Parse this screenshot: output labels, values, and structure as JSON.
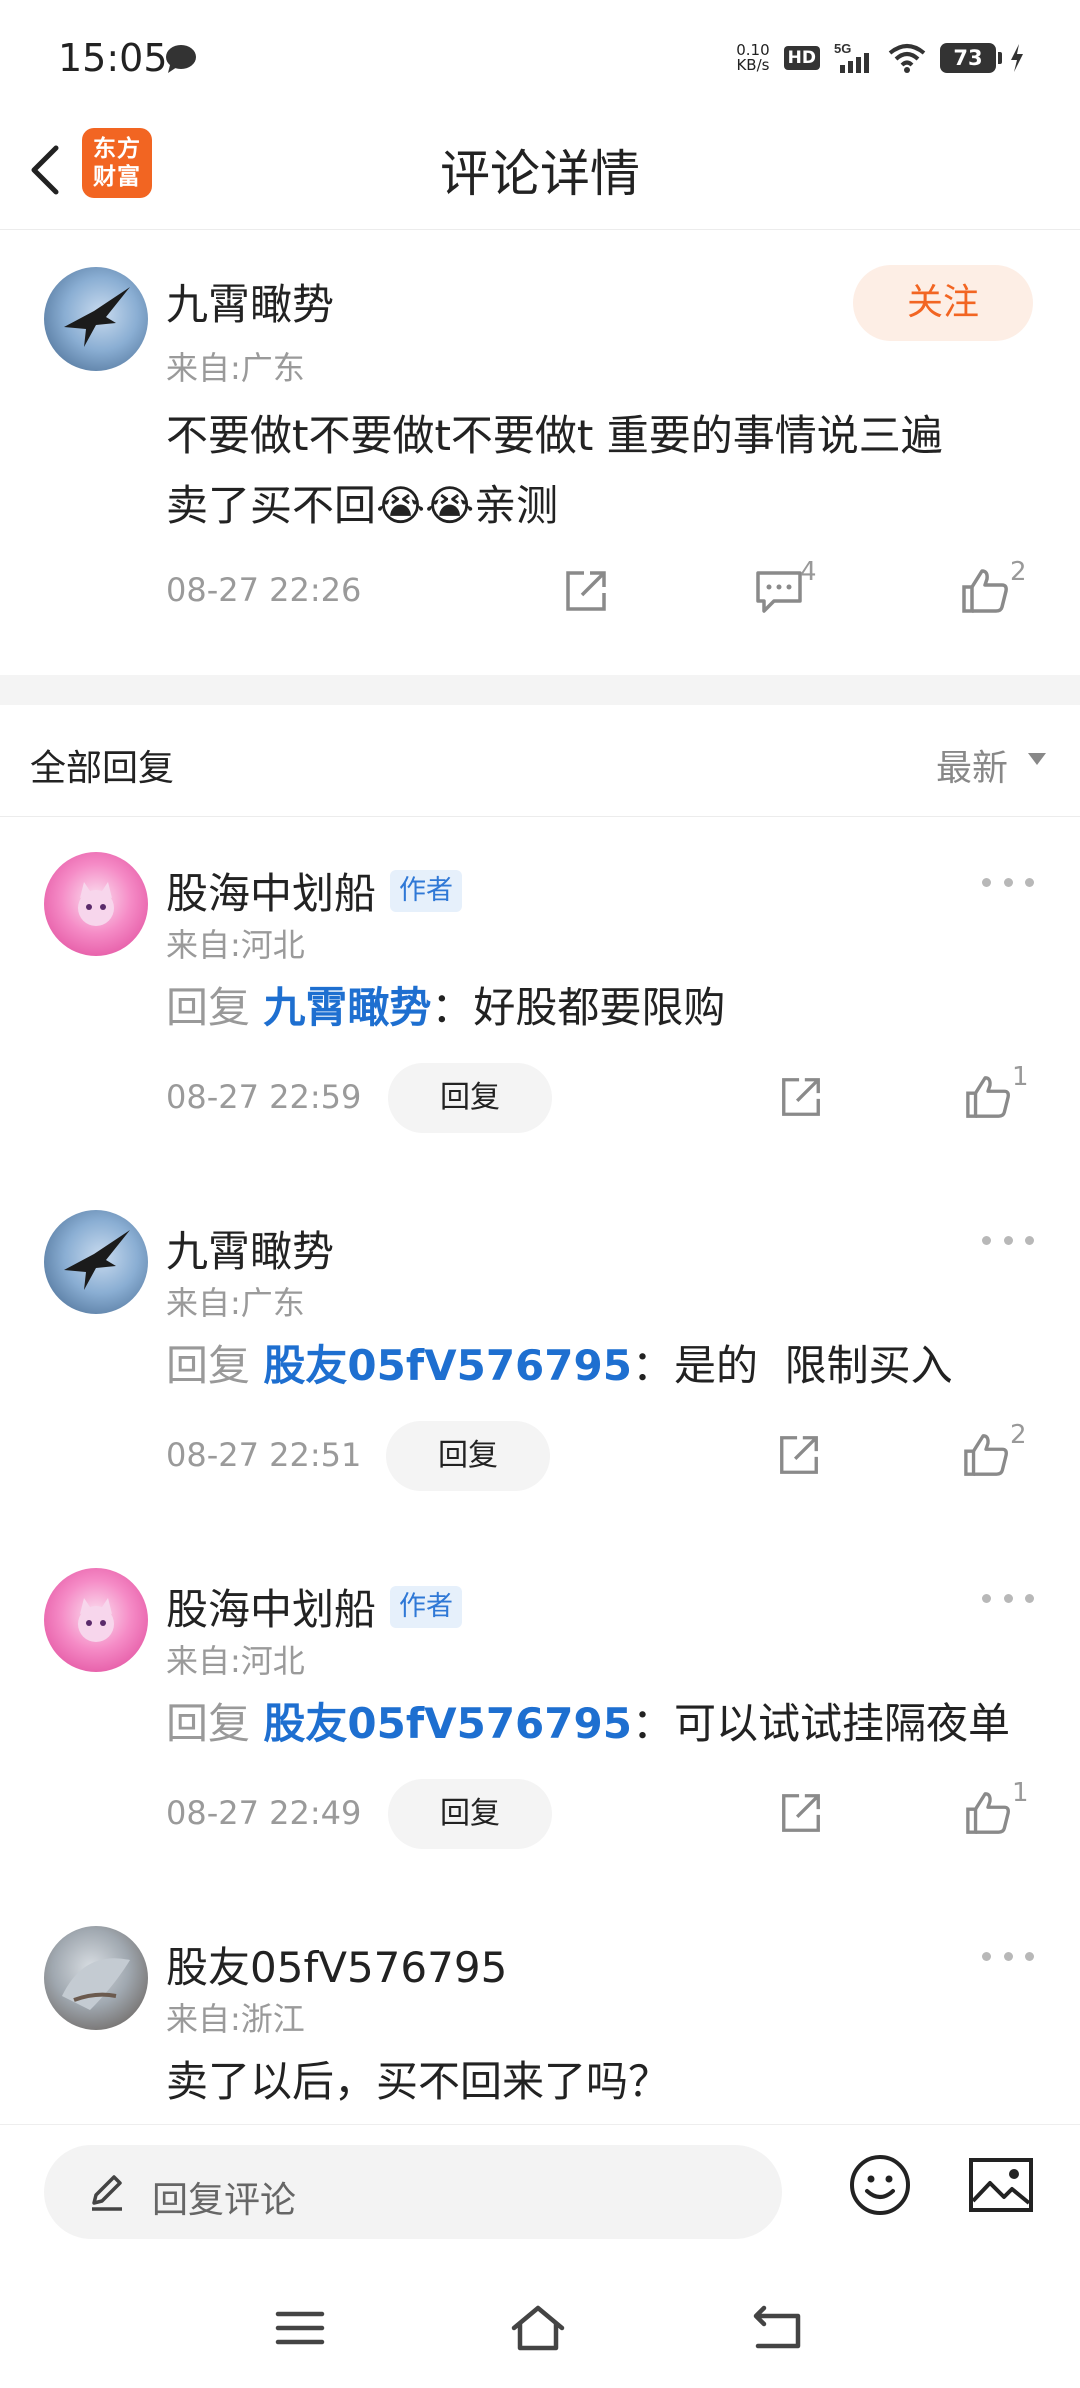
{
  "status_bar": {
    "time": "15:05",
    "net_speed_value": "0.10",
    "net_speed_unit": "KB/s",
    "hd": "HD",
    "network": "5G",
    "battery": "73"
  },
  "nav": {
    "logo_line1": "东方",
    "logo_line2": "财富",
    "title": "评论详情"
  },
  "main_comment": {
    "author": "九霄瞰势",
    "location": "来自:广东",
    "follow_label": "关注",
    "text_line1": "不要做t不要做t不要做t 重要的事情说三遍",
    "text_line2_before": "卖了买不回",
    "emoji": "😭😭",
    "text_line2_after": "亲测",
    "time": "08-27 22:26",
    "comment_count": "4",
    "like_count": "2"
  },
  "list_header": {
    "title": "全部回复",
    "sort": "最新"
  },
  "replies": [
    {
      "author": "股海中划船",
      "author_tag": "作者",
      "location": "来自:河北",
      "prefix": "回复",
      "target": "九霄瞰势",
      "text": "：好股都要限购",
      "time": "08-27 22:59",
      "reply_label": "回复",
      "like_count": "1"
    },
    {
      "author": "九霄瞰势",
      "author_tag": "",
      "location": "来自:广东",
      "prefix": "回复",
      "target": "股友05fV576795",
      "text": "：是的  限制买入",
      "time": "08-27 22:51",
      "reply_label": "回复",
      "like_count": "2"
    },
    {
      "author": "股海中划船",
      "author_tag": "作者",
      "location": "来自:河北",
      "prefix": "回复",
      "target": "股友05fV576795",
      "text": "：可以试试挂隔夜单",
      "time": "08-27 22:49",
      "reply_label": "回复",
      "like_count": "1"
    },
    {
      "author": "股友05fV576795",
      "location": "来自:浙江",
      "text": "卖了以后，买不回来了吗？"
    }
  ],
  "bottom_bar": {
    "placeholder": "回复评论"
  },
  "colors": {
    "accent": "#f26522",
    "link": "#1e6fd0",
    "muted": "#9a9a9a"
  }
}
